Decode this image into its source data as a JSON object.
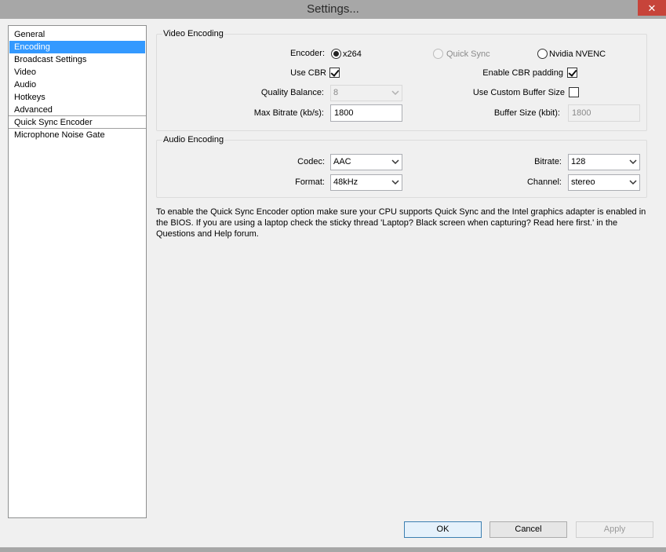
{
  "window": {
    "title": "Settings...",
    "close_glyph": "✕"
  },
  "sidebar": {
    "items": [
      "General",
      "Encoding",
      "Broadcast Settings",
      "Video",
      "Audio",
      "Hotkeys",
      "Advanced",
      "Quick Sync Encoder",
      "Microphone Noise Gate"
    ],
    "selected": "Encoding"
  },
  "video_encoding": {
    "title": "Video Encoding",
    "encoder_label": "Encoder:",
    "encoder_options": [
      "x264",
      "Quick Sync",
      "Nvidia NVENC"
    ],
    "encoder_selected": "x264",
    "use_cbr_label": "Use CBR",
    "use_cbr": true,
    "cbr_padding_label": "Enable CBR padding",
    "cbr_padding": true,
    "quality_balance_label": "Quality Balance:",
    "quality_balance_value": "8",
    "custom_buffer_label": "Use Custom Buffer Size",
    "custom_buffer": false,
    "max_bitrate_label": "Max Bitrate (kb/s):",
    "max_bitrate_value": "1800",
    "buffer_size_label": "Buffer Size (kbit):",
    "buffer_size_value": "1800"
  },
  "audio_encoding": {
    "title": "Audio Encoding",
    "codec_label": "Codec:",
    "codec_value": "AAC",
    "bitrate_label": "Bitrate:",
    "bitrate_value": "128",
    "format_label": "Format:",
    "format_value": "48kHz",
    "channel_label": "Channel:",
    "channel_value": "stereo"
  },
  "info": "To enable the Quick Sync Encoder option make sure your CPU supports Quick Sync and the Intel graphics adapter is enabled in the BIOS. If you are using a laptop check the sticky thread 'Laptop? Black screen when capturing? Read here first.' in the Questions and Help forum.",
  "buttons": {
    "ok": "OK",
    "cancel": "Cancel",
    "apply": "Apply"
  },
  "colors": {
    "selection": "#3399ff",
    "close_button": "#c7443a",
    "frame": "#a7a7a7"
  },
  "icons": {
    "dropdown": "chevron-down-icon",
    "close": "close-icon"
  }
}
